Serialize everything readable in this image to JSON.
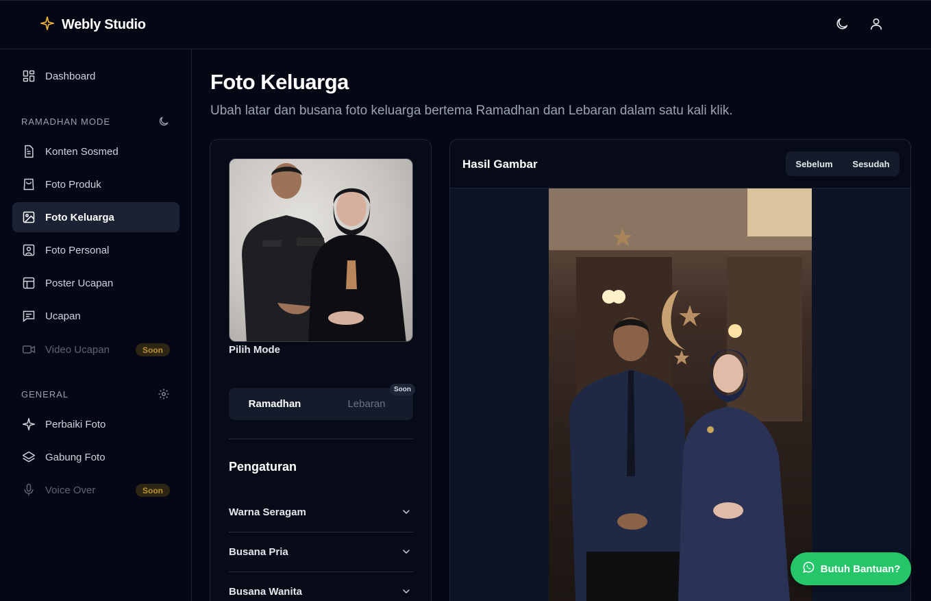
{
  "brand": {
    "name": "Webly Studio",
    "icon": "sparkle-icon",
    "accent": "#f5b83d"
  },
  "topbar": {
    "theme_icon": "moon-icon",
    "user_icon": "user-icon"
  },
  "sidebar": {
    "dashboard": "Dashboard",
    "section_ramadhan": "RAMADHAN MODE",
    "section_general": "GENERAL",
    "items": [
      {
        "label": "Konten Sosmed",
        "icon": "document-icon"
      },
      {
        "label": "Foto Produk",
        "icon": "shopping-bag-icon"
      },
      {
        "label": "Foto Keluarga",
        "icon": "image-icon",
        "active": true
      },
      {
        "label": "Foto Personal",
        "icon": "portrait-icon"
      },
      {
        "label": "Poster Ucapan",
        "icon": "layout-icon"
      },
      {
        "label": "Ucapan",
        "icon": "message-icon"
      },
      {
        "label": "Video Ucapan",
        "icon": "video-icon",
        "badge": "Soon",
        "disabled": true
      }
    ],
    "general_items": [
      {
        "label": "Perbaiki Foto",
        "icon": "sparkle-icon"
      },
      {
        "label": "Gabung Foto",
        "icon": "layers-icon"
      },
      {
        "label": "Voice Over",
        "icon": "microphone-icon",
        "badge": "Soon",
        "disabled": true
      }
    ]
  },
  "main": {
    "title": "Foto Keluarga",
    "subtitle": "Ubah latar dan busana foto keluarga bertema Ramadhan dan Lebaran dalam satu kali klik.",
    "mode_label": "Pilih Mode",
    "modes": {
      "ramadhan": "Ramadhan",
      "lebaran": "Lebaran",
      "lebaran_badge": "Soon"
    },
    "settings_title": "Pengaturan",
    "accordions": [
      "Warna Seragam",
      "Busana Pria",
      "Busana Wanita"
    ],
    "result_title": "Hasil Gambar",
    "before": "Sebelum",
    "after": "Sesudah"
  },
  "help": {
    "label": "Butuh Bantuan?",
    "icon": "whatsapp-icon",
    "color": "#25c56a"
  }
}
